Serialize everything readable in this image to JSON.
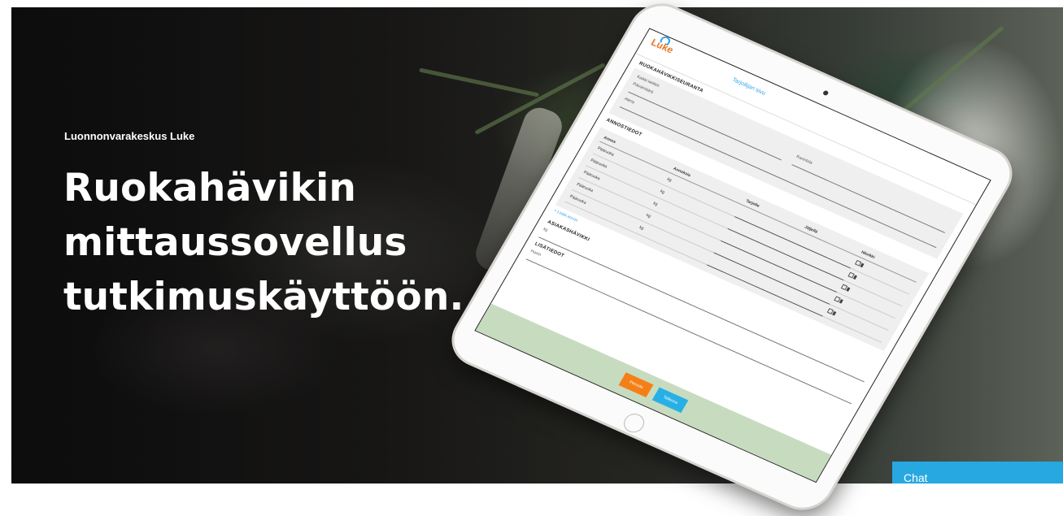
{
  "hero": {
    "eyebrow": "Luonnonvarakeskus Luke",
    "headline": "Ruokahävikin mittaussovellus tutkimuskäyttöön."
  },
  "tablet_app": {
    "logo": "Luke",
    "header_title": "Tarjoilijan sivu",
    "section_measurement": "Ruokahävikkiseuranta",
    "fields": {
      "date": "Päivämäärä",
      "kitchen": "Kaikki keittiöt",
      "restaurant": "Ravintola",
      "meal": "Ateria"
    },
    "section_portions": "Annostiedot",
    "table_headers": [
      "Annos",
      "Annoksia",
      "Tarjolle",
      "Jäljellä",
      "Hävikki"
    ],
    "rows": [
      {
        "name": "Pääruoka",
        "unit": "kg"
      },
      {
        "name": "Pääruoka",
        "unit": "kg"
      },
      {
        "name": "Pääruoka",
        "unit": "kg"
      },
      {
        "name": "Pääruoka",
        "unit": "kg"
      },
      {
        "name": "Pääruoka",
        "unit": "kg"
      }
    ],
    "add_link": "+ Lisää annos",
    "section_waste": "Asiakashävikki",
    "section_notes": "Lisätiedot",
    "bottom_fields": {
      "waste": "kg",
      "notes": "Huom"
    },
    "buttons": {
      "cancel": "Peruuta",
      "save": "Tallenna"
    }
  },
  "chat": {
    "label": "Chat"
  },
  "colors": {
    "accent_blue": "#27a8e0",
    "accent_orange": "#f57f17",
    "footer_green": "#c7dcbf"
  }
}
